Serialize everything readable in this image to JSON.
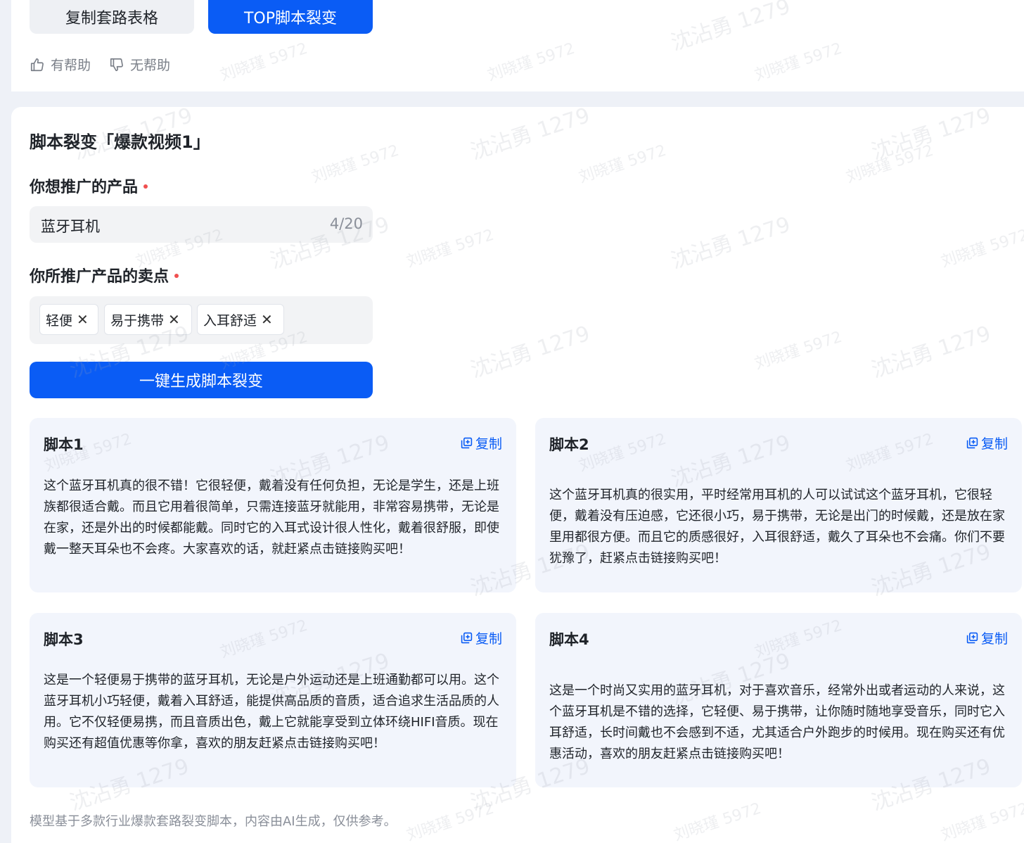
{
  "top": {
    "copy_table_btn": "复制套路表格",
    "top_script_btn": "TOP脚本裂变",
    "helpful": "有帮助",
    "not_helpful": "无帮助"
  },
  "form": {
    "title": "脚本裂变「爆款视频1」",
    "product_label": "你想推广的产品",
    "product_value": "蓝牙耳机",
    "product_count": "4/20",
    "selling_label": "你所推广产品的卖点",
    "tags": [
      "轻便",
      "易于携带",
      "入耳舒适"
    ],
    "generate_btn": "一键生成脚本裂变"
  },
  "scripts": [
    {
      "title": "脚本1",
      "copy": "复制",
      "text": "这个蓝牙耳机真的很不错！它很轻便，戴着没有任何负担，无论是学生，还是上班族都很适合戴。而且它用着很简单，只需连接蓝牙就能用，非常容易携带，无论是在家，还是外出的时候都能戴。同时它的入耳式设计很人性化，戴着很舒服，即使戴一整天耳朵也不会疼。大家喜欢的话，就赶紧点击链接购买吧！"
    },
    {
      "title": "脚本2",
      "copy": "复制",
      "text": "这个蓝牙耳机真的很实用，平时经常用耳机的人可以试试这个蓝牙耳机，它很轻便，戴着没有压迫感，它还很小巧，易于携带，无论是出门的时候戴，还是放在家里用都很方便。而且它的质感很好，入耳很舒适，戴久了耳朵也不会痛。你们不要犹豫了，赶紧点击链接购买吧！"
    },
    {
      "title": "脚本3",
      "copy": "复制",
      "text": "这是一个轻便易于携带的蓝牙耳机，无论是户外运动还是上班通勤都可以用。这个蓝牙耳机小巧轻便，戴着入耳舒适，能提供高品质的音质，适合追求生活品质的人用。它不仅轻便易携，而且音质出色，戴上它就能享受到立体环绕HIFI音质。现在购买还有超值优惠等你拿，喜欢的朋友赶紧点击链接购买吧！"
    },
    {
      "title": "脚本4",
      "copy": "复制",
      "text": "这是一个时尚又实用的蓝牙耳机，对于喜欢音乐，经常外出或者运动的人来说，这个蓝牙耳机是不错的选择，它轻便、易于携带，让你随时随地享受音乐，同时它入耳舒适，长时间戴也不会感到不适，尤其适合户外跑步的时候用。现在购买还有优惠活动，喜欢的朋友赶紧点击链接购买吧！"
    }
  ],
  "footer_note": "模型基于多款行业爆款套路裂变脚本，内容由AI生成，仅供参考。",
  "watermarks": {
    "a": "沈沾勇 1279",
    "b": "刘晓瑾 5972"
  },
  "colors": {
    "accent": "#0a5cf5",
    "required_dot": "#f05050",
    "card_bg": "#f2f5fc"
  }
}
